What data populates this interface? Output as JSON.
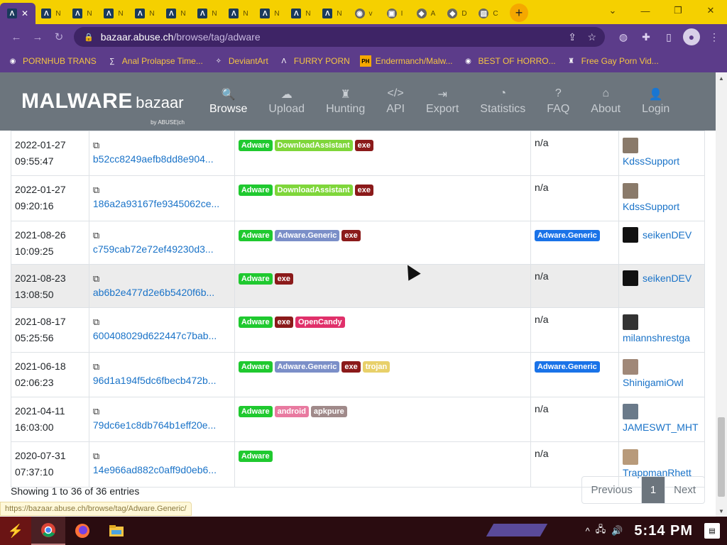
{
  "browser": {
    "tabs": [
      {
        "icon": "Λ",
        "label": "",
        "active": true
      },
      {
        "icon": "Λ",
        "label": "N"
      },
      {
        "icon": "Λ",
        "label": "N"
      },
      {
        "icon": "Λ",
        "label": "N"
      },
      {
        "icon": "Λ",
        "label": "N"
      },
      {
        "icon": "Λ",
        "label": "N"
      },
      {
        "icon": "Λ",
        "label": "N"
      },
      {
        "icon": "Λ",
        "label": "N"
      },
      {
        "icon": "Λ",
        "label": "N"
      },
      {
        "icon": "Λ",
        "label": "N"
      },
      {
        "icon": "Λ",
        "label": "N"
      },
      {
        "icon": "◉",
        "label": "v"
      },
      {
        "icon": "▣",
        "label": "I"
      },
      {
        "icon": "◆",
        "label": "A"
      },
      {
        "icon": "◆",
        "label": "D"
      },
      {
        "icon": "▧",
        "label": "C"
      }
    ],
    "url_domain": "bazaar.abuse.ch",
    "url_path": "/browse/tag/adware",
    "bookmarks": [
      {
        "label": "PORNHUB TRANS"
      },
      {
        "label": "Anal Prolapse Time..."
      },
      {
        "label": "DeviantArt"
      },
      {
        "label": "FURRY PORN"
      },
      {
        "label": "Endermanch/Malw..."
      },
      {
        "label": "BEST OF HORRO..."
      },
      {
        "label": "Free Gay Porn Vid..."
      }
    ],
    "status_url": "https://bazaar.abuse.ch/browse/tag/Adware.Generic/"
  },
  "site": {
    "brand_big": "MALWARE",
    "brand_small": "bazaar",
    "brand_by": "by ABUSE|ch",
    "menu": [
      {
        "label": "Browse",
        "icon": "search-icon",
        "active": true
      },
      {
        "label": "Upload",
        "icon": "cloud-upload-icon"
      },
      {
        "label": "Hunting",
        "icon": "castle-icon"
      },
      {
        "label": "API",
        "icon": "code-icon"
      },
      {
        "label": "Export",
        "icon": "export-icon"
      },
      {
        "label": "Statistics",
        "icon": "pie-chart-icon"
      },
      {
        "label": "FAQ",
        "icon": "question-icon"
      },
      {
        "label": "About",
        "icon": "building-icon"
      },
      {
        "label": "Login",
        "icon": "user-icon"
      }
    ]
  },
  "rows": [
    {
      "date": "2022-01-27",
      "time": "09:55:47",
      "hash": "b52cc8249aefb8dd8e904...",
      "tags": [
        "Adware",
        "DownloadAssistant",
        "exe"
      ],
      "signature": "n/a",
      "reporter": "KdssSupport",
      "reporter_inline": false
    },
    {
      "date": "2022-01-27",
      "time": "09:20:16",
      "hash": "186a2a93167fe9345062ce...",
      "tags": [
        "Adware",
        "DownloadAssistant",
        "exe"
      ],
      "signature": "n/a",
      "reporter": "KdssSupport",
      "reporter_inline": false
    },
    {
      "date": "2021-08-26",
      "time": "10:09:25",
      "hash": "c759cab72e72ef49230d3...",
      "tags": [
        "Adware",
        "Adware.Generic",
        "exe"
      ],
      "signature": "Adware.Generic",
      "reporter": "seikenDEV",
      "reporter_inline": true
    },
    {
      "date": "2021-08-23",
      "time": "13:08:50",
      "hash": "ab6b2e477d2e6b5420f6b...",
      "tags": [
        "Adware",
        "exe"
      ],
      "signature": "n/a",
      "reporter": "seikenDEV",
      "reporter_inline": true,
      "highlight": true
    },
    {
      "date": "2021-08-17",
      "time": "05:25:56",
      "hash": "600408029d622447c7bab...",
      "tags": [
        "Adware",
        "exe",
        "OpenCandy"
      ],
      "signature": "n/a",
      "reporter": "milannshrestga",
      "reporter_inline": false
    },
    {
      "date": "2021-06-18",
      "time": "02:06:23",
      "hash": "96d1a194f5dc6fbecb472b...",
      "tags": [
        "Adware",
        "Adware.Generic",
        "exe",
        "trojan"
      ],
      "signature": "Adware.Generic",
      "reporter": "ShinigamiOwl",
      "reporter_inline": false
    },
    {
      "date": "2021-04-11",
      "time": "16:03:00",
      "hash": "79dc6e1c8db764b1eff20e...",
      "tags": [
        "Adware",
        "android",
        "apkpure"
      ],
      "signature": "n/a",
      "reporter": "JAMESWT_MHT",
      "reporter_inline": false
    },
    {
      "date": "2020-07-31",
      "time": "07:37:10",
      "hash": "14e966ad882c0aff9d0eb6...",
      "tags": [
        "Adware"
      ],
      "signature": "n/a",
      "reporter": "TrappmanRhett",
      "reporter_inline": false
    }
  ],
  "tag_colors": {
    "Adware": "#1fc92f",
    "DownloadAssistant": "#7fd63a",
    "exe": "#8b1a1a",
    "Adware.Generic": "#7b8fc8",
    "OpenCandy": "#e0306a",
    "trojan": "#e8d06a",
    "android": "#e87aa0",
    "apkpure": "#a08a8a",
    "signature": "#1a73e8"
  },
  "table_footer": {
    "showing": "Showing 1 to 36 of 36 entries",
    "prev": "Previous",
    "page": "1",
    "next": "Next"
  },
  "taskbar": {
    "clock": "5:14 PM"
  }
}
